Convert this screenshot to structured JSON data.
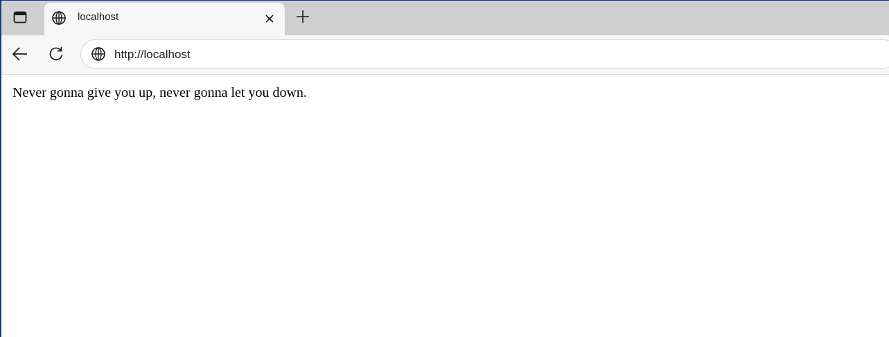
{
  "browser": {
    "tab": {
      "title": "localhost",
      "favicon": "globe-icon"
    },
    "tab_actions_icon": "tab-actions-icon",
    "close_icon": "close-icon",
    "new_tab_icon": "plus-icon",
    "nav": {
      "back_icon": "back-arrow-icon",
      "reload_icon": "reload-icon"
    },
    "address_bar": {
      "url": "http://localhost",
      "site_icon": "globe-icon"
    },
    "colors": {
      "tabstrip_bg": "#cfcfcf",
      "toolbar_bg": "#f7f7f7",
      "window_border": "#1f3a6b"
    }
  },
  "page": {
    "body_text": "Never gonna give you up, never gonna let you down."
  }
}
